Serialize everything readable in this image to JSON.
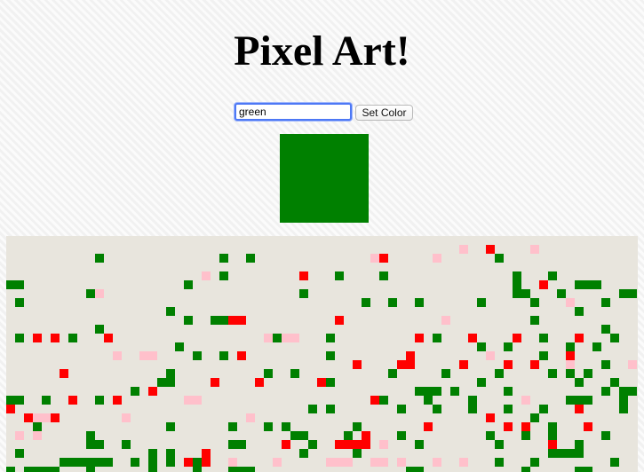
{
  "header": {
    "title": "Pixel Art!"
  },
  "controls": {
    "color_value": "green",
    "set_color_label": "Set Color"
  },
  "swatch": {
    "color": "#008000"
  },
  "palette": {
    "canvas_bg": "#e8e5dd",
    "g": "#008000",
    "r": "#ff0000",
    "p": "#ffc0cb"
  },
  "canvas": {
    "cols": 71,
    "rows": 27,
    "pixels": [
      [
        1,
        51,
        "p"
      ],
      [
        1,
        54,
        "r"
      ],
      [
        1,
        59,
        "p"
      ],
      [
        2,
        10,
        "g"
      ],
      [
        2,
        24,
        "g"
      ],
      [
        2,
        27,
        "g"
      ],
      [
        2,
        41,
        "p"
      ],
      [
        2,
        42,
        "r"
      ],
      [
        2,
        48,
        "p"
      ],
      [
        2,
        55,
        "g"
      ],
      [
        4,
        22,
        "p"
      ],
      [
        4,
        24,
        "g"
      ],
      [
        4,
        33,
        "r"
      ],
      [
        4,
        37,
        "g"
      ],
      [
        4,
        42,
        "g"
      ],
      [
        4,
        57,
        "g"
      ],
      [
        4,
        61,
        "g"
      ],
      [
        5,
        0,
        "g"
      ],
      [
        5,
        1,
        "g"
      ],
      [
        5,
        20,
        "g"
      ],
      [
        5,
        57,
        "g"
      ],
      [
        5,
        60,
        "r"
      ],
      [
        5,
        64,
        "g"
      ],
      [
        5,
        65,
        "g"
      ],
      [
        5,
        66,
        "g"
      ],
      [
        6,
        9,
        "g"
      ],
      [
        6,
        10,
        "p"
      ],
      [
        6,
        33,
        "g"
      ],
      [
        6,
        57,
        "g"
      ],
      [
        6,
        58,
        "g"
      ],
      [
        6,
        62,
        "g"
      ],
      [
        6,
        69,
        "g"
      ],
      [
        6,
        70,
        "g"
      ],
      [
        7,
        1,
        "g"
      ],
      [
        7,
        40,
        "g"
      ],
      [
        7,
        43,
        "g"
      ],
      [
        7,
        46,
        "g"
      ],
      [
        7,
        53,
        "g"
      ],
      [
        7,
        59,
        "g"
      ],
      [
        7,
        63,
        "p"
      ],
      [
        7,
        67,
        "g"
      ],
      [
        8,
        18,
        "g"
      ],
      [
        8,
        64,
        "g"
      ],
      [
        9,
        20,
        "g"
      ],
      [
        9,
        23,
        "g"
      ],
      [
        9,
        24,
        "g"
      ],
      [
        9,
        25,
        "r"
      ],
      [
        9,
        26,
        "r"
      ],
      [
        9,
        37,
        "r"
      ],
      [
        9,
        49,
        "p"
      ],
      [
        9,
        59,
        "g"
      ],
      [
        10,
        10,
        "g"
      ],
      [
        10,
        67,
        "g"
      ],
      [
        11,
        1,
        "g"
      ],
      [
        11,
        3,
        "r"
      ],
      [
        11,
        5,
        "r"
      ],
      [
        11,
        7,
        "g"
      ],
      [
        11,
        11,
        "r"
      ],
      [
        11,
        29,
        "p"
      ],
      [
        11,
        30,
        "g"
      ],
      [
        11,
        31,
        "p"
      ],
      [
        11,
        32,
        "p"
      ],
      [
        11,
        36,
        "g"
      ],
      [
        11,
        46,
        "r"
      ],
      [
        11,
        48,
        "g"
      ],
      [
        11,
        52,
        "r"
      ],
      [
        11,
        57,
        "r"
      ],
      [
        11,
        60,
        "g"
      ],
      [
        11,
        64,
        "r"
      ],
      [
        11,
        68,
        "g"
      ],
      [
        12,
        19,
        "g"
      ],
      [
        12,
        53,
        "g"
      ],
      [
        12,
        56,
        "g"
      ],
      [
        12,
        63,
        "g"
      ],
      [
        12,
        66,
        "g"
      ],
      [
        13,
        12,
        "p"
      ],
      [
        13,
        15,
        "p"
      ],
      [
        13,
        16,
        "p"
      ],
      [
        13,
        21,
        "g"
      ],
      [
        13,
        24,
        "g"
      ],
      [
        13,
        26,
        "r"
      ],
      [
        13,
        36,
        "g"
      ],
      [
        13,
        45,
        "r"
      ],
      [
        13,
        54,
        "p"
      ],
      [
        13,
        60,
        "g"
      ],
      [
        13,
        63,
        "r"
      ],
      [
        14,
        39,
        "r"
      ],
      [
        14,
        44,
        "r"
      ],
      [
        14,
        45,
        "r"
      ],
      [
        14,
        51,
        "r"
      ],
      [
        14,
        56,
        "r"
      ],
      [
        14,
        59,
        "r"
      ],
      [
        14,
        63,
        "p"
      ],
      [
        14,
        67,
        "g"
      ],
      [
        14,
        70,
        "p"
      ],
      [
        15,
        6,
        "r"
      ],
      [
        15,
        18,
        "g"
      ],
      [
        15,
        29,
        "g"
      ],
      [
        15,
        32,
        "g"
      ],
      [
        15,
        43,
        "g"
      ],
      [
        15,
        49,
        "g"
      ],
      [
        15,
        55,
        "g"
      ],
      [
        15,
        61,
        "g"
      ],
      [
        15,
        63,
        "g"
      ],
      [
        15,
        65,
        "g"
      ],
      [
        16,
        17,
        "g"
      ],
      [
        16,
        18,
        "g"
      ],
      [
        16,
        23,
        "r"
      ],
      [
        16,
        28,
        "r"
      ],
      [
        16,
        35,
        "r"
      ],
      [
        16,
        36,
        "g"
      ],
      [
        16,
        53,
        "g"
      ],
      [
        16,
        64,
        "g"
      ],
      [
        16,
        68,
        "g"
      ],
      [
        17,
        14,
        "g"
      ],
      [
        17,
        16,
        "r"
      ],
      [
        17,
        46,
        "g"
      ],
      [
        17,
        47,
        "g"
      ],
      [
        17,
        48,
        "g"
      ],
      [
        17,
        50,
        "g"
      ],
      [
        17,
        56,
        "g"
      ],
      [
        17,
        67,
        "g"
      ],
      [
        17,
        69,
        "g"
      ],
      [
        17,
        70,
        "g"
      ],
      [
        18,
        0,
        "g"
      ],
      [
        18,
        1,
        "g"
      ],
      [
        18,
        4,
        "g"
      ],
      [
        18,
        7,
        "r"
      ],
      [
        18,
        10,
        "g"
      ],
      [
        18,
        12,
        "r"
      ],
      [
        18,
        20,
        "p"
      ],
      [
        18,
        21,
        "p"
      ],
      [
        18,
        41,
        "r"
      ],
      [
        18,
        42,
        "g"
      ],
      [
        18,
        47,
        "g"
      ],
      [
        18,
        52,
        "g"
      ],
      [
        18,
        58,
        "p"
      ],
      [
        18,
        63,
        "g"
      ],
      [
        18,
        64,
        "g"
      ],
      [
        18,
        65,
        "g"
      ],
      [
        18,
        69,
        "g"
      ],
      [
        19,
        0,
        "r"
      ],
      [
        19,
        34,
        "g"
      ],
      [
        19,
        36,
        "g"
      ],
      [
        19,
        44,
        "g"
      ],
      [
        19,
        48,
        "g"
      ],
      [
        19,
        52,
        "g"
      ],
      [
        19,
        56,
        "g"
      ],
      [
        19,
        60,
        "g"
      ],
      [
        19,
        64,
        "r"
      ],
      [
        19,
        69,
        "g"
      ],
      [
        20,
        2,
        "r"
      ],
      [
        20,
        3,
        "p"
      ],
      [
        20,
        4,
        "p"
      ],
      [
        20,
        5,
        "r"
      ],
      [
        20,
        13,
        "p"
      ],
      [
        20,
        27,
        "p"
      ],
      [
        20,
        54,
        "r"
      ],
      [
        20,
        59,
        "g"
      ],
      [
        21,
        3,
        "g"
      ],
      [
        21,
        18,
        "g"
      ],
      [
        21,
        25,
        "g"
      ],
      [
        21,
        29,
        "g"
      ],
      [
        21,
        31,
        "g"
      ],
      [
        21,
        39,
        "g"
      ],
      [
        21,
        47,
        "r"
      ],
      [
        21,
        56,
        "r"
      ],
      [
        21,
        58,
        "r"
      ],
      [
        21,
        61,
        "g"
      ],
      [
        21,
        65,
        "r"
      ],
      [
        22,
        1,
        "p"
      ],
      [
        22,
        3,
        "p"
      ],
      [
        22,
        9,
        "g"
      ],
      [
        22,
        32,
        "g"
      ],
      [
        22,
        33,
        "g"
      ],
      [
        22,
        38,
        "g"
      ],
      [
        22,
        40,
        "r"
      ],
      [
        22,
        44,
        "g"
      ],
      [
        22,
        54,
        "g"
      ],
      [
        22,
        58,
        "g"
      ],
      [
        22,
        61,
        "g"
      ],
      [
        22,
        67,
        "g"
      ],
      [
        23,
        9,
        "g"
      ],
      [
        23,
        10,
        "g"
      ],
      [
        23,
        13,
        "g"
      ],
      [
        23,
        25,
        "g"
      ],
      [
        23,
        26,
        "g"
      ],
      [
        23,
        31,
        "r"
      ],
      [
        23,
        34,
        "g"
      ],
      [
        23,
        37,
        "r"
      ],
      [
        23,
        38,
        "r"
      ],
      [
        23,
        39,
        "r"
      ],
      [
        23,
        40,
        "r"
      ],
      [
        23,
        42,
        "p"
      ],
      [
        23,
        46,
        "g"
      ],
      [
        23,
        55,
        "g"
      ],
      [
        23,
        61,
        "r"
      ],
      [
        23,
        64,
        "g"
      ],
      [
        24,
        1,
        "g"
      ],
      [
        24,
        16,
        "g"
      ],
      [
        24,
        18,
        "g"
      ],
      [
        24,
        22,
        "r"
      ],
      [
        24,
        33,
        "g"
      ],
      [
        24,
        39,
        "g"
      ],
      [
        24,
        61,
        "g"
      ],
      [
        24,
        62,
        "g"
      ],
      [
        24,
        63,
        "g"
      ],
      [
        24,
        64,
        "g"
      ],
      [
        25,
        6,
        "g"
      ],
      [
        25,
        7,
        "g"
      ],
      [
        25,
        8,
        "g"
      ],
      [
        25,
        9,
        "g"
      ],
      [
        25,
        10,
        "g"
      ],
      [
        25,
        11,
        "g"
      ],
      [
        25,
        14,
        "g"
      ],
      [
        25,
        16,
        "g"
      ],
      [
        25,
        18,
        "g"
      ],
      [
        25,
        20,
        "r"
      ],
      [
        25,
        21,
        "g"
      ],
      [
        25,
        22,
        "r"
      ],
      [
        25,
        25,
        "p"
      ],
      [
        25,
        30,
        "p"
      ],
      [
        25,
        36,
        "p"
      ],
      [
        25,
        37,
        "p"
      ],
      [
        25,
        38,
        "p"
      ],
      [
        25,
        41,
        "p"
      ],
      [
        25,
        42,
        "p"
      ],
      [
        25,
        44,
        "p"
      ],
      [
        25,
        48,
        "p"
      ],
      [
        25,
        51,
        "p"
      ],
      [
        25,
        55,
        "g"
      ],
      [
        25,
        59,
        "g"
      ],
      [
        25,
        68,
        "g"
      ],
      [
        26,
        0,
        "g"
      ],
      [
        26,
        2,
        "g"
      ],
      [
        26,
        3,
        "g"
      ],
      [
        26,
        4,
        "g"
      ],
      [
        26,
        5,
        "g"
      ],
      [
        26,
        9,
        "g"
      ],
      [
        26,
        16,
        "g"
      ],
      [
        26,
        21,
        "g"
      ],
      [
        26,
        25,
        "g"
      ],
      [
        26,
        26,
        "g"
      ],
      [
        26,
        27,
        "g"
      ],
      [
        26,
        45,
        "g"
      ],
      [
        26,
        46,
        "g"
      ],
      [
        26,
        58,
        "g"
      ],
      [
        26,
        64,
        "g"
      ],
      [
        26,
        65,
        "g"
      ]
    ]
  }
}
